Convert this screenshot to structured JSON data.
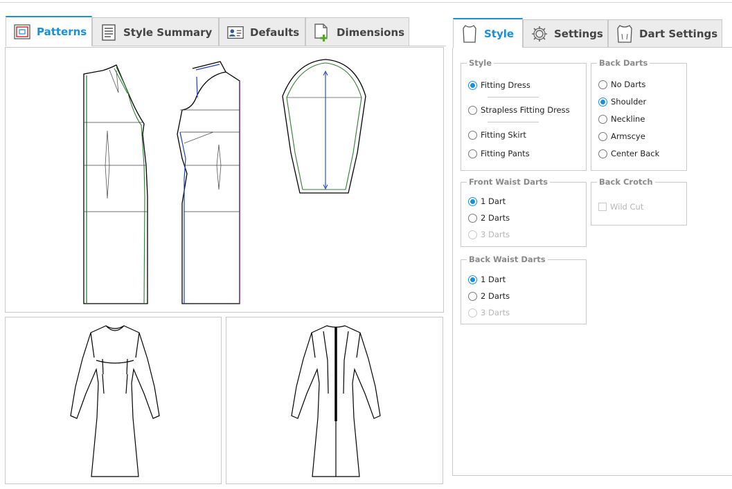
{
  "left_tabs": [
    {
      "label": "Patterns",
      "icon": "patterns-icon",
      "active": true
    },
    {
      "label": "Style Summary",
      "icon": "document-icon",
      "active": false
    },
    {
      "label": "Defaults",
      "icon": "user-card-icon",
      "active": false
    },
    {
      "label": "Dimensions",
      "icon": "add-document-icon",
      "active": false
    }
  ],
  "right_tabs": [
    {
      "label": "Style",
      "icon": "shirt-icon",
      "active": true
    },
    {
      "label": "Settings",
      "icon": "gear-icon",
      "active": false
    },
    {
      "label": "Dart Settings",
      "icon": "dart-shirt-icon",
      "active": false
    }
  ],
  "style_group": {
    "title": "Style",
    "options": [
      {
        "label": "Fitting Dress",
        "checked": true
      },
      {
        "label": "Strapless Fitting Dress",
        "checked": false
      },
      {
        "label": "Fitting Skirt",
        "checked": false
      },
      {
        "label": "Fitting Pants",
        "checked": false
      }
    ]
  },
  "back_darts_group": {
    "title": "Back Darts",
    "options": [
      {
        "label": "No Darts",
        "checked": false
      },
      {
        "label": "Shoulder",
        "checked": true
      },
      {
        "label": "Neckline",
        "checked": false
      },
      {
        "label": "Armscye",
        "checked": false
      },
      {
        "label": "Center Back",
        "checked": false
      }
    ]
  },
  "front_waist_darts_group": {
    "title": "Front Waist Darts",
    "options": [
      {
        "label": "1 Dart",
        "checked": true,
        "disabled": false
      },
      {
        "label": "2 Darts",
        "checked": false,
        "disabled": false
      },
      {
        "label": "3 Darts",
        "checked": false,
        "disabled": true
      }
    ]
  },
  "back_crotch_group": {
    "title": "Back Crotch",
    "checkbox": {
      "label": "Wild Cut",
      "checked": false,
      "disabled": true
    }
  },
  "back_waist_darts_group": {
    "title": "Back Waist Darts",
    "options": [
      {
        "label": "1 Dart",
        "checked": true,
        "disabled": false
      },
      {
        "label": "2 Darts",
        "checked": false,
        "disabled": false
      },
      {
        "label": "3 Darts",
        "checked": false,
        "disabled": true
      }
    ]
  },
  "colors": {
    "accent": "#1a8fd8",
    "border": "#c8c8c8",
    "pattern_green": "#2e7d32",
    "pattern_blue": "#1f3fbf",
    "pattern_purple": "#7b1fa2"
  }
}
